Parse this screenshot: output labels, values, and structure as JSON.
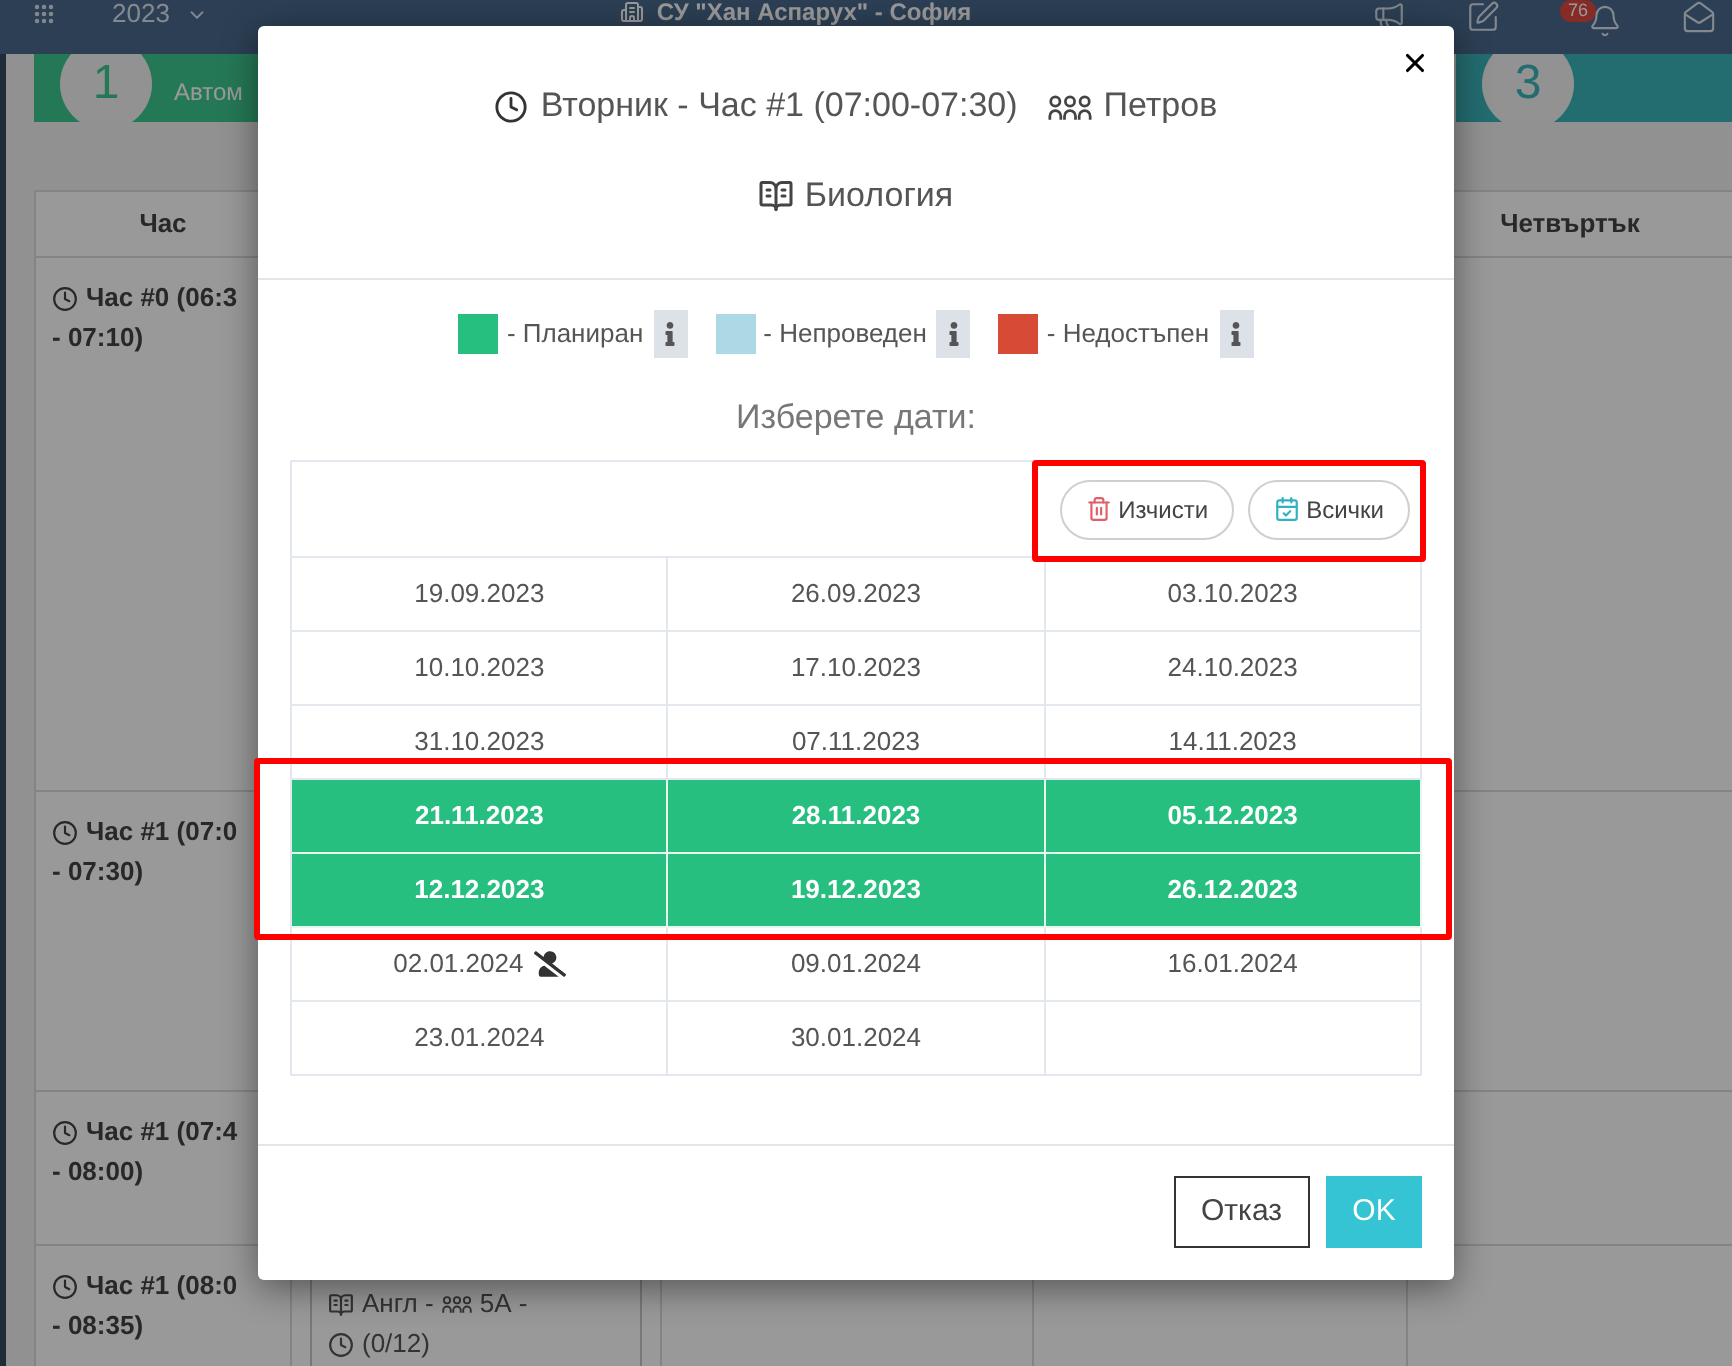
{
  "navbar": {
    "year": "2023",
    "title": "СУ \"Хан Аспарух\" - София",
    "badge": "76"
  },
  "summary_cards": [
    {
      "number": "1",
      "caption": "Автом"
    },
    {
      "number": "3"
    }
  ],
  "schedule": {
    "hour_heading": "Час",
    "day_headings": [
      "Четвъртък"
    ],
    "rows": [
      {
        "hour": "Час #0 (06:3",
        "end": "- 07:10)"
      },
      {
        "hour": "Час #1 (07:0",
        "end": "- 07:30)"
      },
      {
        "hour": "Час #1 (07:4",
        "end": "- 08:00)"
      },
      {
        "hour": "Час #1 (08:0",
        "end": "- 08:35)",
        "lessons": [
          {
            "subject": "Англ -",
            "group": "5А -",
            "hours": "(0/12)"
          }
        ]
      }
    ]
  },
  "dialog": {
    "lesson_time": "Вторник - Час #1 (07:00-07:30)",
    "teacher": "Петров",
    "subject": "Биология",
    "legend": [
      {
        "label": "- Планиран",
        "color": "#26bf7f"
      },
      {
        "label": "- Непроведен",
        "color": "#add8e6"
      },
      {
        "label": "- Недостъпен",
        "color": "#d64a36"
      }
    ],
    "prompt": "Изберете дати:",
    "actions": [
      {
        "label": "Изчисти",
        "kind": "clear"
      },
      {
        "label": "Всички",
        "kind": "all"
      }
    ],
    "dates": [
      [
        {
          "date": "19.09.2023",
          "selected": false,
          "teacher_absent": false
        },
        {
          "date": "26.09.2023",
          "selected": false,
          "teacher_absent": false
        },
        {
          "date": "03.10.2023",
          "selected": false,
          "teacher_absent": false
        }
      ],
      [
        {
          "date": "10.10.2023",
          "selected": false,
          "teacher_absent": false
        },
        {
          "date": "17.10.2023",
          "selected": false,
          "teacher_absent": false
        },
        {
          "date": "24.10.2023",
          "selected": false,
          "teacher_absent": false
        }
      ],
      [
        {
          "date": "31.10.2023",
          "selected": false,
          "teacher_absent": false
        },
        {
          "date": "07.11.2023",
          "selected": false,
          "teacher_absent": false
        },
        {
          "date": "14.11.2023",
          "selected": false,
          "teacher_absent": false
        }
      ],
      [
        {
          "date": "21.11.2023",
          "selected": true,
          "teacher_absent": false
        },
        {
          "date": "28.11.2023",
          "selected": true,
          "teacher_absent": false
        },
        {
          "date": "05.12.2023",
          "selected": true,
          "teacher_absent": false
        }
      ],
      [
        {
          "date": "12.12.2023",
          "selected": true,
          "teacher_absent": false
        },
        {
          "date": "19.12.2023",
          "selected": true,
          "teacher_absent": false
        },
        {
          "date": "26.12.2023",
          "selected": true,
          "teacher_absent": false
        }
      ],
      [
        {
          "date": "02.01.2024",
          "selected": false,
          "teacher_absent": true
        },
        {
          "date": "09.01.2024",
          "selected": false,
          "teacher_absent": false
        },
        {
          "date": "16.01.2024",
          "selected": false,
          "teacher_absent": false
        }
      ],
      [
        {
          "date": "23.01.2024",
          "selected": false,
          "teacher_absent": false
        },
        {
          "date": "30.01.2024",
          "selected": false,
          "teacher_absent": false
        }
      ]
    ],
    "buttons": [
      {
        "label": "Отказ",
        "kind": "secondary"
      },
      {
        "label": "OK",
        "kind": "primary"
      }
    ]
  }
}
